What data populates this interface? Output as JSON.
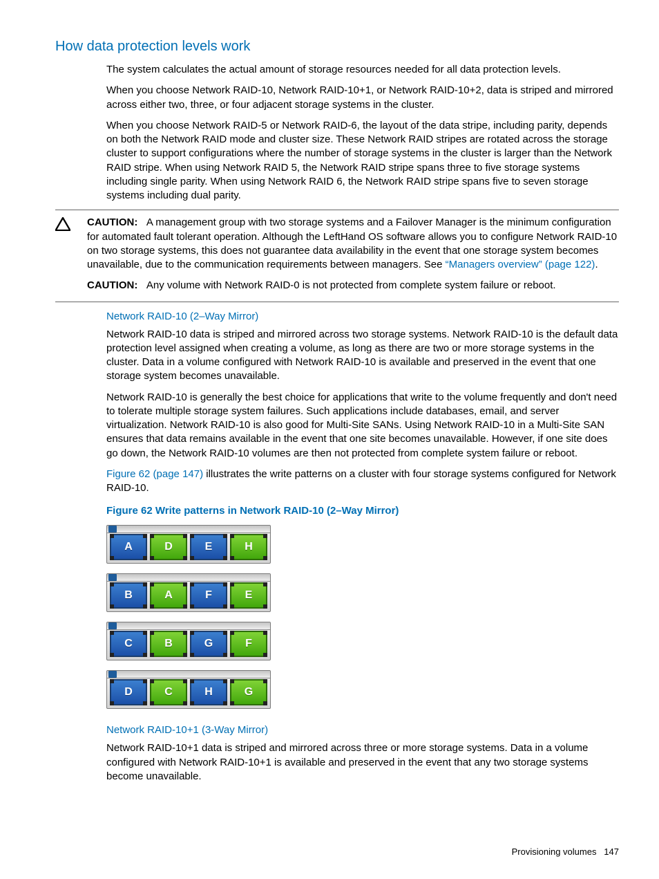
{
  "headings": {
    "main": "How data protection levels work"
  },
  "intro": {
    "p1": "The system calculates the actual amount of storage resources needed for all data protection levels.",
    "p2": "When you choose Network RAID-10, Network RAID-10+1, or Network RAID-10+2, data is striped and mirrored across either two, three, or four adjacent storage systems in the cluster.",
    "p3": "When you choose Network RAID-5 or Network RAID-6, the layout of the data stripe, including parity, depends on both the Network RAID mode and cluster size. These Network RAID stripes are rotated across the storage cluster to support configurations where the number of storage systems in the cluster is larger than the Network RAID stripe. When using Network RAID 5, the Network RAID stripe spans three to five storage systems including single parity. When using Network RAID 6, the Network RAID stripe spans five to seven storage systems including dual parity."
  },
  "cautions": [
    {
      "label": "CAUTION:",
      "textBefore": "A management group with two storage systems and a Failover Manager is the minimum configuration for automated fault tolerant operation. Although the LeftHand OS software allows you to configure Network RAID-10 on two storage systems, this does not guarantee data availability in the event that one storage system becomes unavailable, due to the communication requirements between managers. See ",
      "linkText": "“Managers overview” (page 122)",
      "textAfter": "."
    },
    {
      "label": "CAUTION:",
      "text": "Any volume with Network RAID-0 is not protected from complete system failure or reboot."
    }
  ],
  "sections": {
    "raid10": {
      "heading": "Network RAID-10 (2–Way Mirror)",
      "p1": "Network RAID-10 data is striped and mirrored across two storage systems. Network RAID-10 is the default data protection level assigned when creating a volume, as long as there are two or more storage systems in the cluster. Data in a volume configured with Network RAID-10 is available and preserved in the event that one storage system becomes unavailable.",
      "p2": "Network RAID-10 is generally the best choice for applications that write to the volume frequently and don't need to tolerate multiple storage system failures. Such applications include databases, email, and server virtualization. Network RAID-10 is also good for Multi-Site SANs. Using Network RAID-10 in a Multi-Site SAN ensures that data remains available in the event that one site becomes unavailable. However, if one site does go down, the Network RAID-10 volumes are then not protected from complete system failure or reboot.",
      "figlink": "Figure 62 (page 147)",
      "p3": "illustrates the write patterns on a cluster with four storage systems configured for Network RAID-10."
    },
    "raid10p1": {
      "heading": "Network RAID-10+1 (3-Way Mirror)",
      "p1": "Network RAID-10+1 data is striped and mirrored across three or more storage systems. Data in a volume configured with Network RAID-10+1 is available and preserved in the event that any two storage systems become unavailable."
    }
  },
  "figure": {
    "title": "Figure 62 Write patterns in Network RAID-10 (2–Way Mirror)",
    "systems": [
      {
        "bays": [
          {
            "l": "A",
            "c": "blue"
          },
          {
            "l": "D",
            "c": "green"
          },
          {
            "l": "E",
            "c": "blue"
          },
          {
            "l": "H",
            "c": "green"
          }
        ]
      },
      {
        "bays": [
          {
            "l": "B",
            "c": "blue"
          },
          {
            "l": "A",
            "c": "green"
          },
          {
            "l": "F",
            "c": "blue"
          },
          {
            "l": "E",
            "c": "green"
          }
        ]
      },
      {
        "bays": [
          {
            "l": "C",
            "c": "blue"
          },
          {
            "l": "B",
            "c": "green"
          },
          {
            "l": "G",
            "c": "blue"
          },
          {
            "l": "F",
            "c": "green"
          }
        ]
      },
      {
        "bays": [
          {
            "l": "D",
            "c": "blue"
          },
          {
            "l": "C",
            "c": "green"
          },
          {
            "l": "H",
            "c": "blue"
          },
          {
            "l": "G",
            "c": "green"
          }
        ]
      }
    ]
  },
  "footer": {
    "section": "Provisioning volumes",
    "page": "147"
  }
}
